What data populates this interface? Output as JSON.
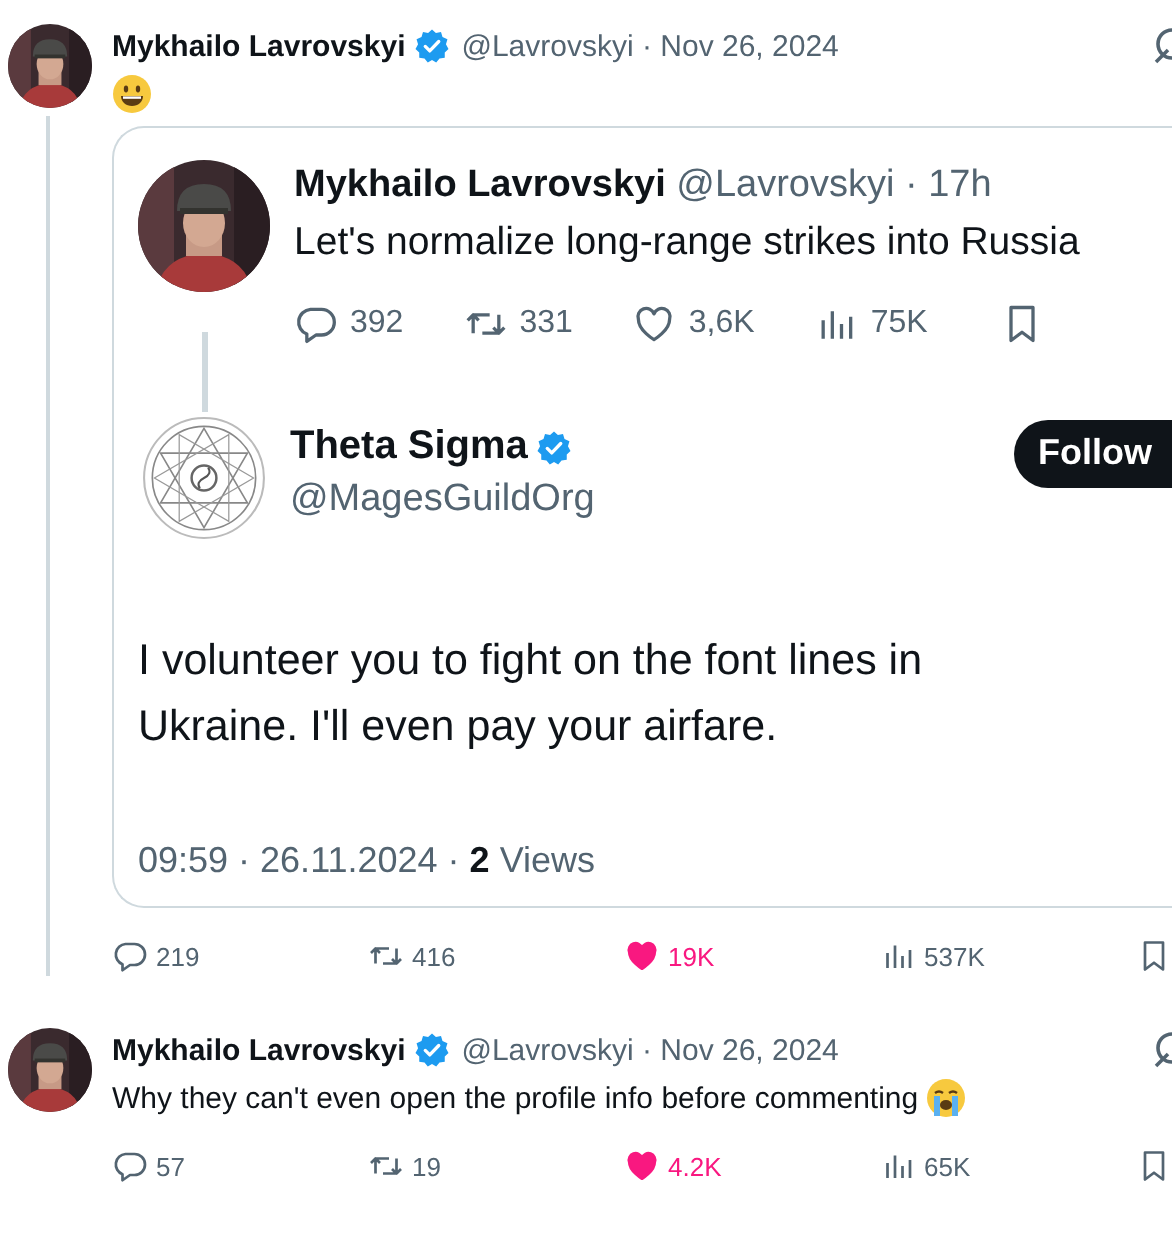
{
  "tweets": [
    {
      "name": "Mykhailo Lavrovskyi",
      "verified": true,
      "meta": "@Lavrovskyi · Nov 26, 2024",
      "emoji": {
        "kind": "grinning"
      },
      "quote": {
        "original": {
          "name": "Mykhailo Lavrovskyi",
          "meta": "@Lavrovskyi · 17h",
          "text": "Let's normalize long-range strikes into Russia",
          "stats": {
            "replies": "392",
            "reposts": "331",
            "likes": "3,6K",
            "views": "75K"
          }
        },
        "reply": {
          "name": "Theta Sigma",
          "verified": true,
          "handle": "@MagesGuildOrg",
          "follow": "Follow",
          "lines": [
            "I volunteer you to fight on the font lines in",
            "Ukraine. I'll even pay your airfare."
          ],
          "footer": "09:59 · 26.11.2024 · **2** Views"
        }
      },
      "stats": {
        "replies": "219",
        "reposts": "416",
        "likes": "19K",
        "views": "537K",
        "liked": true
      }
    },
    {
      "name": "Mykhailo Lavrovskyi",
      "verified": true,
      "meta": "@Lavrovskyi · Nov 26, 2024",
      "text": "Why they can't even open the profile info before commenting",
      "emoji": {
        "kind": "crying"
      },
      "stats": {
        "replies": "57",
        "reposts": "19",
        "likes": "4.2K",
        "views": "65K",
        "liked": true
      }
    }
  ]
}
